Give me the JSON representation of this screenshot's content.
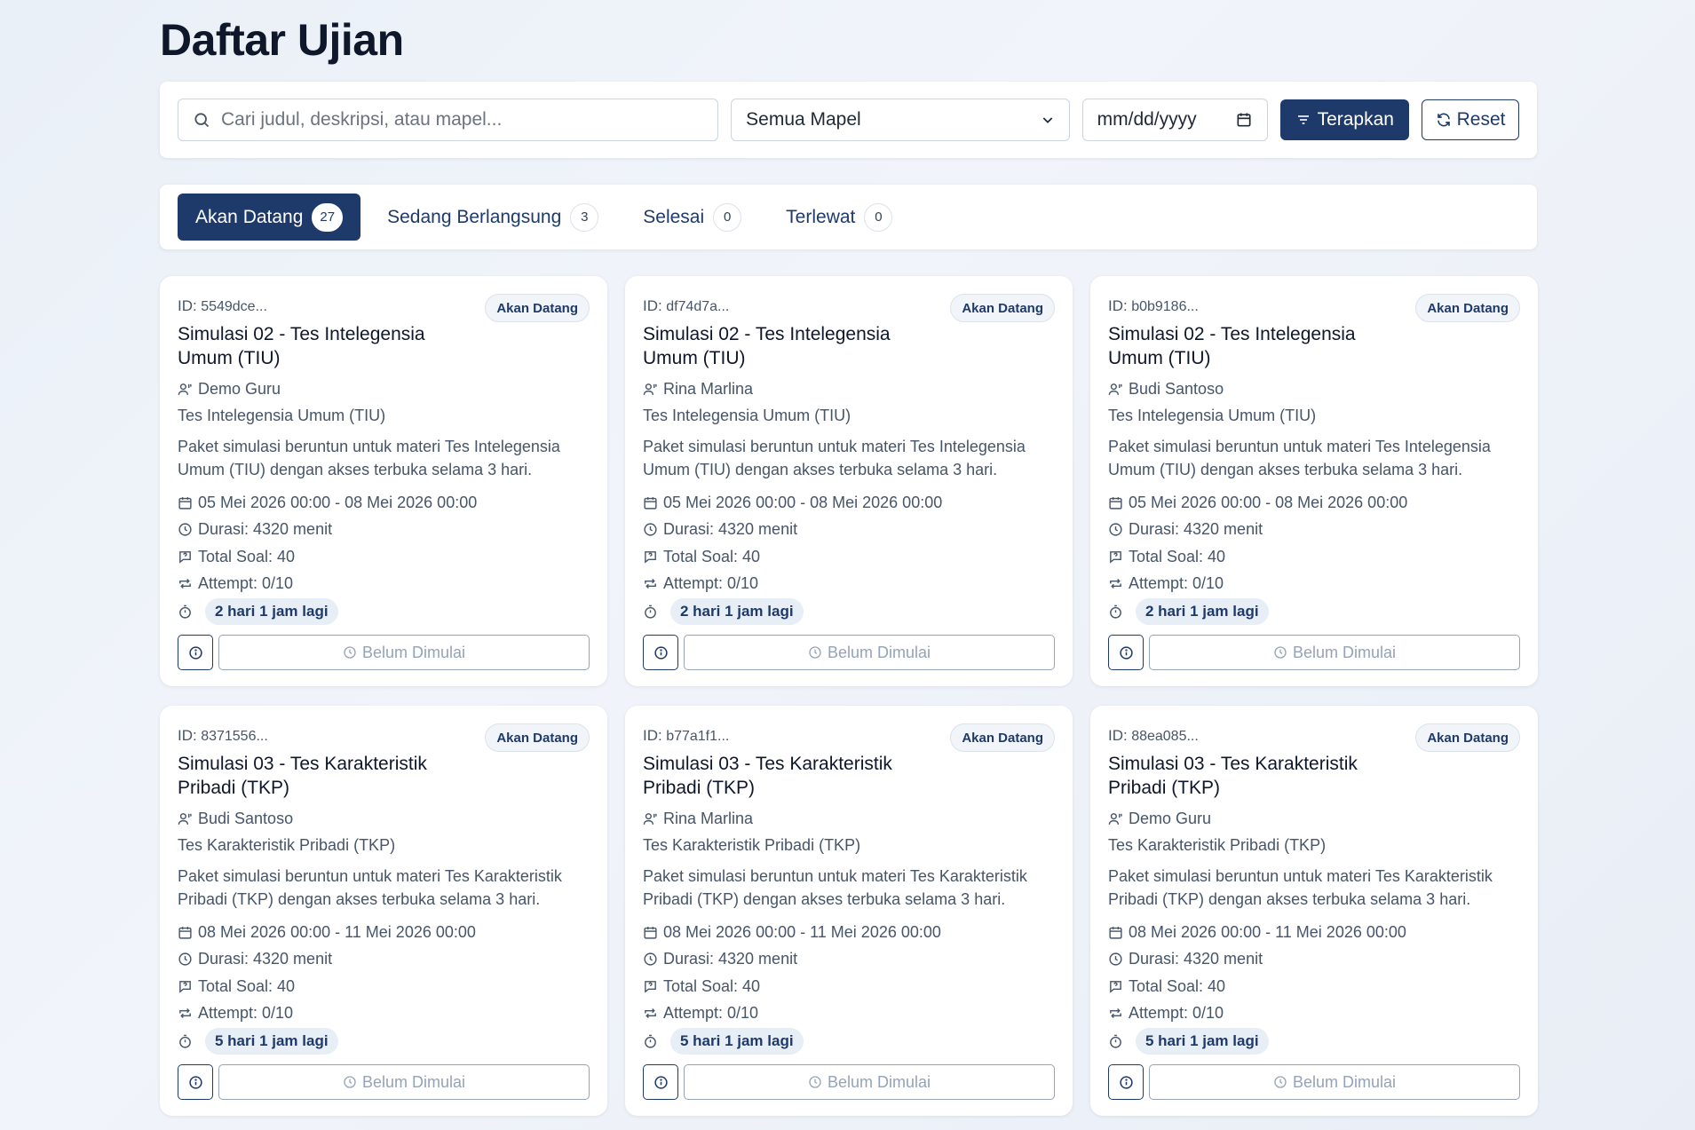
{
  "page_title": "Daftar Ujian",
  "filters": {
    "search_placeholder": "Cari judul, deskripsi, atau mapel...",
    "subject_select": "Semua Mapel",
    "date_placeholder": "mm/dd/yyyy",
    "apply_label": "Terapkan",
    "reset_label": "Reset"
  },
  "tabs": [
    {
      "label": "Akan Datang",
      "count": "27",
      "active": true
    },
    {
      "label": "Sedang Berlangsung",
      "count": "3",
      "active": false
    },
    {
      "label": "Selesai",
      "count": "0",
      "active": false
    },
    {
      "label": "Terlewat",
      "count": "0",
      "active": false
    }
  ],
  "cards": [
    {
      "id_label": "ID:",
      "id": "5549dce...",
      "status": "Akan Datang",
      "title": "Simulasi 02 - Tes Intelegensia Umum (TIU)",
      "teacher": "Demo Guru",
      "subject": "Tes Intelegensia Umum (TIU)",
      "description": "Paket simulasi beruntun untuk materi Tes Intelegensia Umum (TIU) dengan akses terbuka selama 3 hari.",
      "schedule": "05 Mei 2026 00:00 - 08 Mei 2026 00:00",
      "duration": "Durasi: 4320 menit",
      "total_questions": "Total Soal: 40",
      "attempt": "Attempt: 0/10",
      "countdown": "2 hari 1 jam lagi",
      "action_label": "Belum Dimulai"
    },
    {
      "id_label": "ID:",
      "id": "df74d7a...",
      "status": "Akan Datang",
      "title": "Simulasi 02 - Tes Intelegensia Umum (TIU)",
      "teacher": "Rina Marlina",
      "subject": "Tes Intelegensia Umum (TIU)",
      "description": "Paket simulasi beruntun untuk materi Tes Intelegensia Umum (TIU) dengan akses terbuka selama 3 hari.",
      "schedule": "05 Mei 2026 00:00 - 08 Mei 2026 00:00",
      "duration": "Durasi: 4320 menit",
      "total_questions": "Total Soal: 40",
      "attempt": "Attempt: 0/10",
      "countdown": "2 hari 1 jam lagi",
      "action_label": "Belum Dimulai"
    },
    {
      "id_label": "ID:",
      "id": "b0b9186...",
      "status": "Akan Datang",
      "title": "Simulasi 02 - Tes Intelegensia Umum (TIU)",
      "teacher": "Budi Santoso",
      "subject": "Tes Intelegensia Umum (TIU)",
      "description": "Paket simulasi beruntun untuk materi Tes Intelegensia Umum (TIU) dengan akses terbuka selama 3 hari.",
      "schedule": "05 Mei 2026 00:00 - 08 Mei 2026 00:00",
      "duration": "Durasi: 4320 menit",
      "total_questions": "Total Soal: 40",
      "attempt": "Attempt: 0/10",
      "countdown": "2 hari 1 jam lagi",
      "action_label": "Belum Dimulai"
    },
    {
      "id_label": "ID:",
      "id": "8371556...",
      "status": "Akan Datang",
      "title": "Simulasi 03 - Tes Karakteristik Pribadi (TKP)",
      "teacher": "Budi Santoso",
      "subject": "Tes Karakteristik Pribadi (TKP)",
      "description": "Paket simulasi beruntun untuk materi Tes Karakteristik Pribadi (TKP) dengan akses terbuka selama 3 hari.",
      "schedule": "08 Mei 2026 00:00 - 11 Mei 2026 00:00",
      "duration": "Durasi: 4320 menit",
      "total_questions": "Total Soal: 40",
      "attempt": "Attempt: 0/10",
      "countdown": "5 hari 1 jam lagi",
      "action_label": "Belum Dimulai"
    },
    {
      "id_label": "ID:",
      "id": "b77a1f1...",
      "status": "Akan Datang",
      "title": "Simulasi 03 - Tes Karakteristik Pribadi (TKP)",
      "teacher": "Rina Marlina",
      "subject": "Tes Karakteristik Pribadi (TKP)",
      "description": "Paket simulasi beruntun untuk materi Tes Karakteristik Pribadi (TKP) dengan akses terbuka selama 3 hari.",
      "schedule": "08 Mei 2026 00:00 - 11 Mei 2026 00:00",
      "duration": "Durasi: 4320 menit",
      "total_questions": "Total Soal: 40",
      "attempt": "Attempt: 0/10",
      "countdown": "5 hari 1 jam lagi",
      "action_label": "Belum Dimulai"
    },
    {
      "id_label": "ID:",
      "id": "88ea085...",
      "status": "Akan Datang",
      "title": "Simulasi 03 - Tes Karakteristik Pribadi (TKP)",
      "teacher": "Demo Guru",
      "subject": "Tes Karakteristik Pribadi (TKP)",
      "description": "Paket simulasi beruntun untuk materi Tes Karakteristik Pribadi (TKP) dengan akses terbuka selama 3 hari.",
      "schedule": "08 Mei 2026 00:00 - 11 Mei 2026 00:00",
      "duration": "Durasi: 4320 menit",
      "total_questions": "Total Soal: 40",
      "attempt": "Attempt: 0/10",
      "countdown": "5 hari 1 jam lagi",
      "action_label": "Belum Dimulai"
    }
  ],
  "icons": [
    "search-icon",
    "chevron-down-icon",
    "calendar-icon",
    "filter-icon",
    "refresh-icon",
    "user-icon",
    "clock-icon",
    "question-icon",
    "repeat-icon",
    "timer-icon",
    "info-icon"
  ],
  "colors": {
    "primary": "#1e3a6b",
    "muted": "#94a3b8",
    "badge_bg": "#f1f5f9"
  }
}
